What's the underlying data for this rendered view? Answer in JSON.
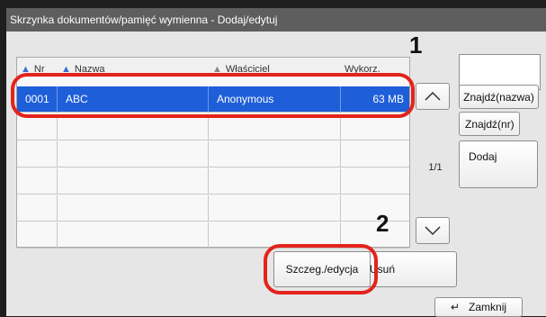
{
  "dialog": {
    "title": "Skrzynka dokumentów/pamięć wymienna - Dodaj/edytuj"
  },
  "table": {
    "columns": [
      "Nr",
      "Nazwa",
      "Właściciel",
      "Wykorz."
    ],
    "rows": [
      {
        "nr": "0001",
        "name": "ABC",
        "owner": "Anonymous",
        "usage": "63  MB",
        "selected": true
      }
    ]
  },
  "pager": {
    "indicator": "1/1"
  },
  "buttons": {
    "find_name": "Znajdź(nazwa)",
    "find_number": "Znajdź(nr)",
    "add": "Dodaj",
    "details_edit": "Szczeg./edycja",
    "delete": "Usuń",
    "close": "Zamknij"
  },
  "annotations": {
    "step1": "1",
    "step2": "2"
  },
  "colors": {
    "highlight": "#e3231b",
    "selected_row": "#1e5ed8",
    "titlebar": "#5e5e5e"
  }
}
